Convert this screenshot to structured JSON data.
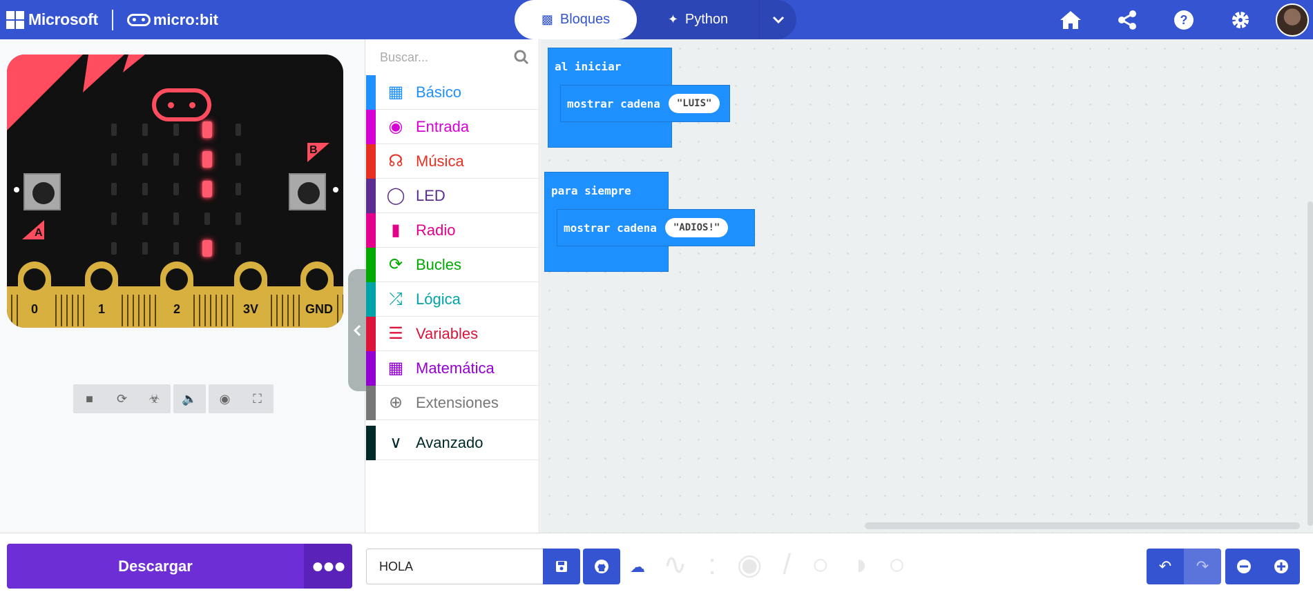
{
  "header": {
    "brand_ms": "Microsoft",
    "brand_mb": "micro:bit",
    "mode_blocks": "Bloques",
    "mode_python": "Python",
    "icons": [
      "home-icon",
      "share-icon",
      "help-icon",
      "settings-icon"
    ]
  },
  "simulator": {
    "button_a": "A",
    "button_b": "B",
    "pins": [
      "0",
      "1",
      "2",
      "3V",
      "GND"
    ],
    "led_grid": [
      [
        0,
        0,
        0,
        1,
        0
      ],
      [
        0,
        0,
        0,
        1,
        0
      ],
      [
        0,
        0,
        0,
        1,
        0
      ],
      [
        0,
        0,
        0,
        0,
        0
      ],
      [
        0,
        0,
        0,
        1,
        0
      ]
    ]
  },
  "toolbox": {
    "search_placeholder": "Buscar...",
    "categories": [
      {
        "label": "Básico",
        "color": "#1e90ff",
        "icon": "grid-icon"
      },
      {
        "label": "Entrada",
        "color": "#d400d4",
        "icon": "target-icon"
      },
      {
        "label": "Música",
        "color": "#e63022",
        "icon": "headphones-icon"
      },
      {
        "label": "LED",
        "color": "#5c2d91",
        "icon": "toggle-icon"
      },
      {
        "label": "Radio",
        "color": "#e3008c",
        "icon": "signal-icon"
      },
      {
        "label": "Bucles",
        "color": "#00aa00",
        "icon": "refresh-icon"
      },
      {
        "label": "Lógica",
        "color": "#00a4a6",
        "icon": "shuffle-icon"
      },
      {
        "label": "Variables",
        "color": "#dc143c",
        "icon": "list-icon"
      },
      {
        "label": "Matemática",
        "color": "#9400d3",
        "icon": "calculator-icon"
      },
      {
        "label": "Extensiones",
        "color": "#777777",
        "icon": "plus-circle-icon"
      },
      {
        "label": "Avanzado",
        "color": "#002a2a",
        "icon": "chevron-down-icon"
      }
    ]
  },
  "workspace": {
    "block1": {
      "title": "al iniciar",
      "cmd": "mostrar cadena",
      "value": "LUIS"
    },
    "block2": {
      "title": "para siempre",
      "cmd": "mostrar cadena",
      "value": "ADIOS!"
    }
  },
  "bottom": {
    "download_label": "Descargar",
    "project_name": "HOLA"
  }
}
